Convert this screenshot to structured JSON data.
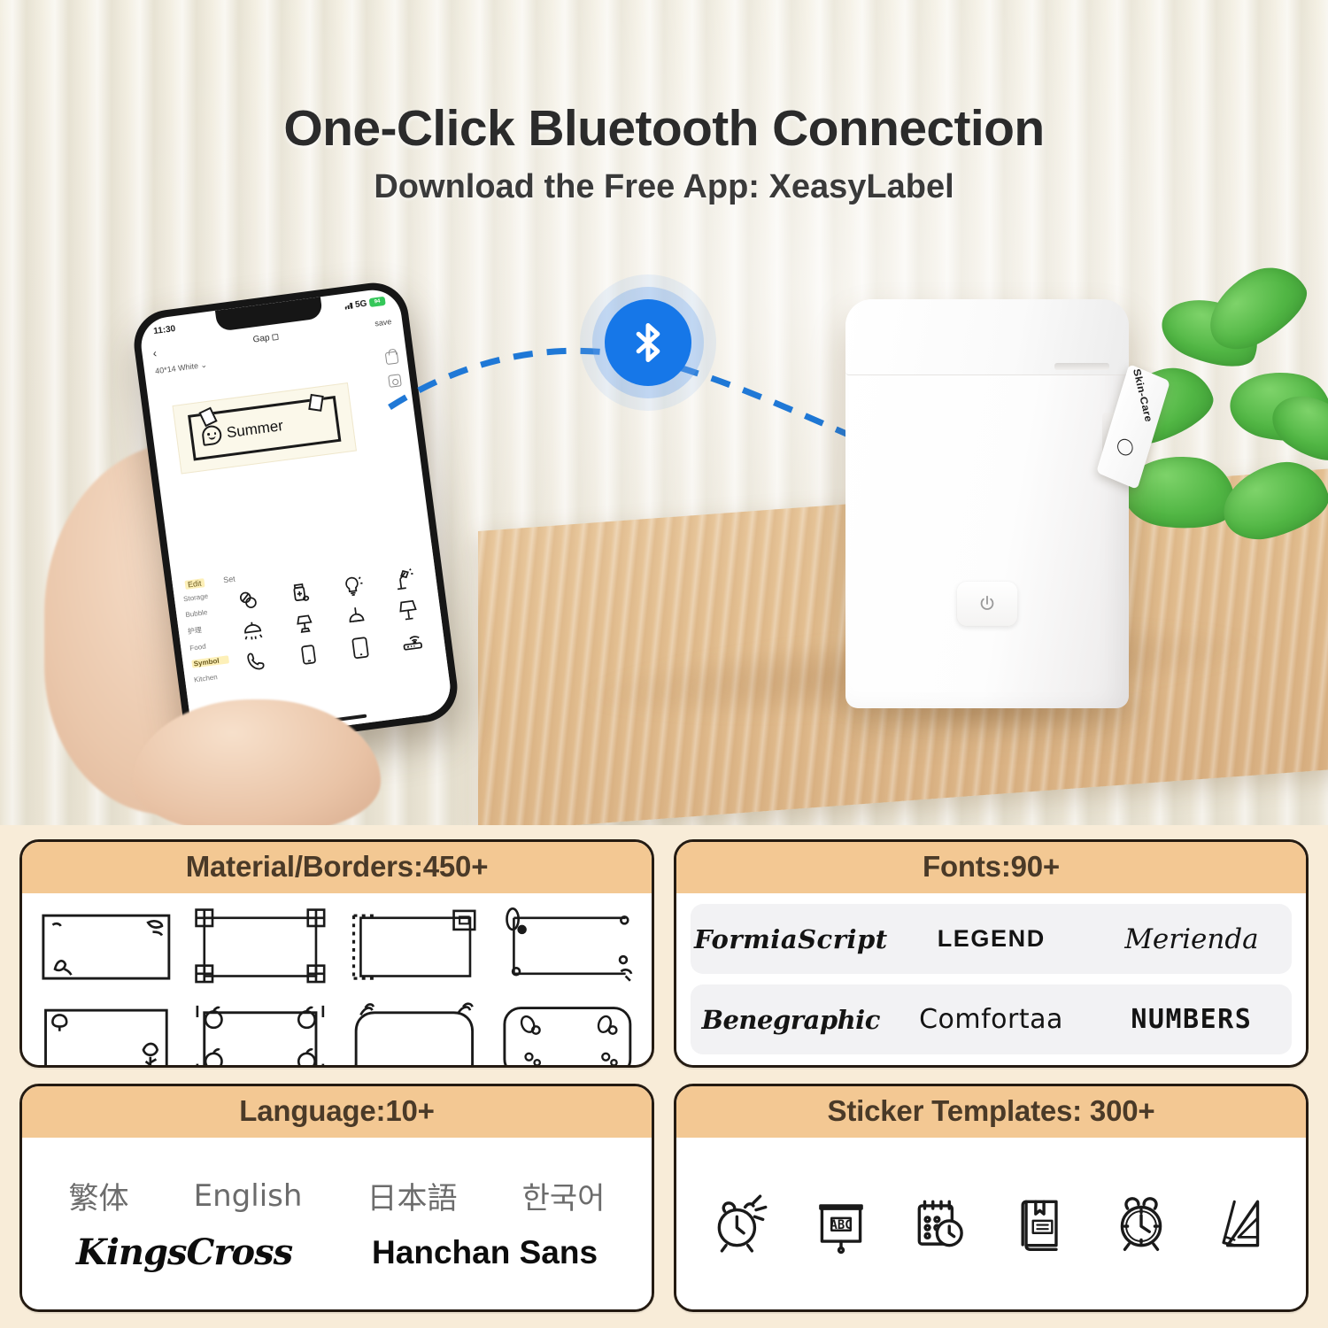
{
  "hero": {
    "title": "One-Click Bluetooth Connection",
    "subtitle": "Download the Free App: XeasyLabel",
    "bluetooth_icon": "bluetooth-icon",
    "accent_blue": "#1677e8"
  },
  "phone": {
    "status": {
      "time": "11:30",
      "network": "5G",
      "battery": "94"
    },
    "nav": {
      "back": "‹",
      "title": "Gap",
      "save": "save"
    },
    "subbar": {
      "size": "40*14 White ⌄",
      "right": ""
    },
    "rail": [
      "lock-icon",
      "image-icon"
    ],
    "preview": {
      "text": "Summer",
      "icon": "smiley-face-icon"
    },
    "tabs": [
      {
        "label": "Edit",
        "active": true
      },
      {
        "label": "Set",
        "active": false
      }
    ],
    "categories": [
      {
        "label": "Storage",
        "active": false
      },
      {
        "label": "Bubble",
        "active": false
      },
      {
        "label": "护理",
        "active": false
      },
      {
        "label": "Food",
        "active": false
      },
      {
        "label": "Symbol",
        "active": true
      },
      {
        "label": "Kitchen",
        "active": false
      }
    ],
    "grid_icons": [
      "pills-icon",
      "medicine-bottle-icon",
      "lightbulb-icon",
      "desk-lamp-icon",
      "ceiling-light-icon",
      "table-lamp-icon",
      "pendant-light-icon",
      "floor-lamp-icon",
      "phone-handset-icon",
      "smartphone-icon",
      "tablet-icon",
      "wifi-router-icon"
    ]
  },
  "printer": {
    "power_icon": "power-icon",
    "tape_text": "Skin-Care",
    "tape_icon": "face-icon"
  },
  "panels": [
    {
      "id": "materials",
      "title": "Material/Borders:450+",
      "thumbs": [
        "border-leaf-corner",
        "border-knot-corners",
        "border-dotted-frame",
        "border-dots-circles",
        "border-mushroom",
        "border-apple-corners",
        "border-arched-top",
        "border-petals-rounded"
      ]
    },
    {
      "id": "fonts",
      "title": "Fonts:90+",
      "rows": [
        [
          "FormiaScript",
          "LEGEND",
          "Merienda"
        ],
        [
          "Benegraphic",
          "Comfortaa",
          "NUMBERS"
        ]
      ]
    },
    {
      "id": "language",
      "title": "Language:10+",
      "languages": [
        "繁体",
        "English",
        "日本語",
        "한국어"
      ],
      "fonts": [
        "KingsCross",
        "Hanchan Sans"
      ]
    },
    {
      "id": "stickers",
      "title": "Sticker Templates: 300+",
      "icons": [
        "alarm-clock-ringing-icon",
        "abc-presentation-board-icon",
        "calendar-clock-icon",
        "book-bookmark-icon",
        "alarm-clock-icon",
        "ruler-triangle-icon"
      ]
    }
  ],
  "colors": {
    "panel_header": "#f3c893",
    "panel_border": "#241b12",
    "page_background": "#f8ecd8",
    "bluetooth": "#1677e8"
  }
}
